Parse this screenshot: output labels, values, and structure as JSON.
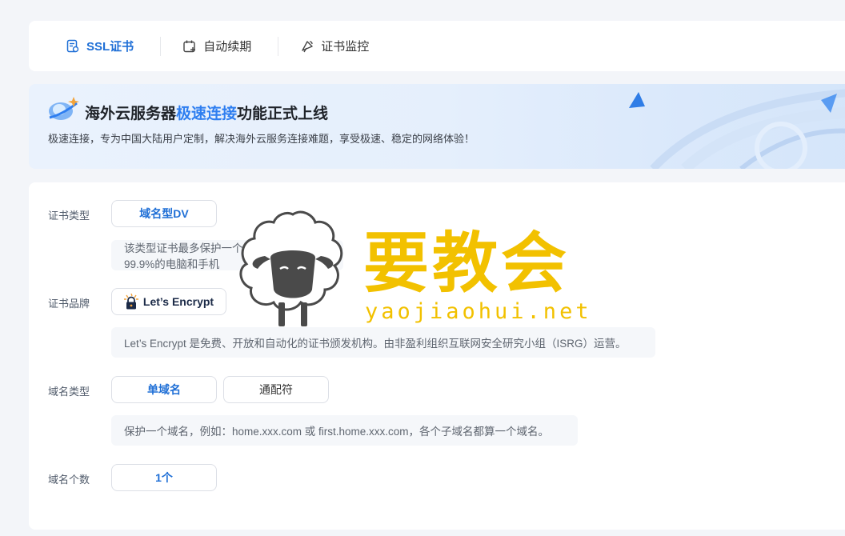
{
  "tabs": [
    {
      "label": "SSL证书",
      "icon": "certificate-icon",
      "active": true
    },
    {
      "label": "自动续期",
      "icon": "calendar-renew-icon",
      "active": false
    },
    {
      "label": "证书监控",
      "icon": "monitor-icon",
      "active": false
    }
  ],
  "banner": {
    "title_prefix": "海外云服务器",
    "title_highlight": "极速连接",
    "title_suffix": "功能正式上线",
    "description": "极速连接，专为中国大陆用户定制，解决海外云服务连接难题，享受极速、稳定的网络体验！"
  },
  "form": {
    "cert_type": {
      "label": "证书类型",
      "options": [
        "域名型DV"
      ],
      "selected": "域名型DV",
      "hint": "该类型证书最多保护一个域名，支持超过99.9%的电脑和手机"
    },
    "cert_brand": {
      "label": "证书品牌",
      "options": [
        "Let’s Encrypt"
      ],
      "selected": "Let’s Encrypt",
      "hint": "Let’s Encrypt 是免费、开放和自动化的证书颁发机构。由非盈利组织互联网安全研究小组（ISRG）运营。"
    },
    "domain_type": {
      "label": "域名类型",
      "options": [
        "单域名",
        "通配符"
      ],
      "selected": "单域名",
      "hint": "保护一个域名，例如：home.xxx.com 或 first.home.xxx.com，各个子域名都算一个域名。"
    },
    "domain_count": {
      "label": "域名个数",
      "value": "1个"
    }
  },
  "watermark": {
    "text": "要教会",
    "url": "yaojiaohui.net"
  },
  "colors": {
    "accent": "#1f6fd6",
    "highlight": "#2e7ef0",
    "watermark": "#f2c100"
  }
}
